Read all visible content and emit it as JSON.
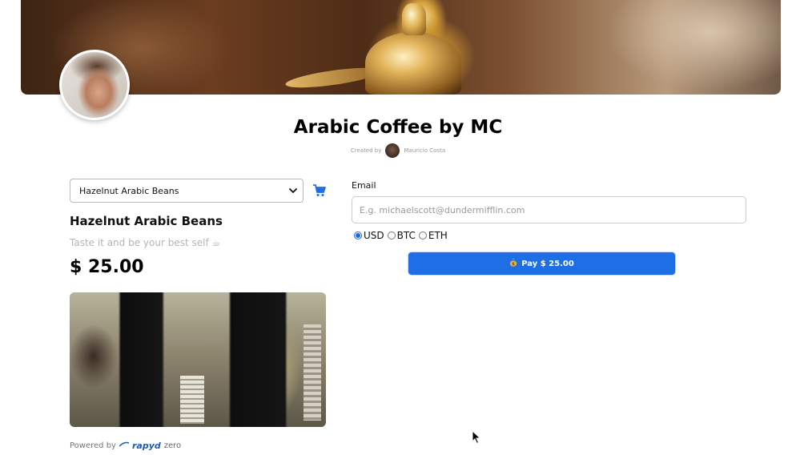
{
  "banner": {
    "alt": "arabic coffee pot banner"
  },
  "page": {
    "title": "Arabic Coffee by MC",
    "created_by_label": "Created by",
    "creator_name": "Mauricio Costa"
  },
  "product": {
    "select_value": "Hazelnut Arabic Beans",
    "name": "Hazelnut Arabic Beans",
    "description": "Taste it and be your best self ☕",
    "price": "$ 25.00"
  },
  "footer": {
    "powered_by": "Powered by",
    "brand": "rapyd",
    "brand_suffix": "zero"
  },
  "checkout": {
    "email_label": "Email",
    "email_placeholder": "E.g. michaelscott@dundermifflin.com",
    "currencies": [
      {
        "label": "USD",
        "selected": true
      },
      {
        "label": "BTC",
        "selected": false
      },
      {
        "label": "ETH",
        "selected": false
      }
    ],
    "pay_label": "Pay $ 25.00",
    "pay_icon": "money-bag-icon"
  },
  "colors": {
    "accent": "#1e6fe6",
    "cart": "#1e6fe6"
  }
}
